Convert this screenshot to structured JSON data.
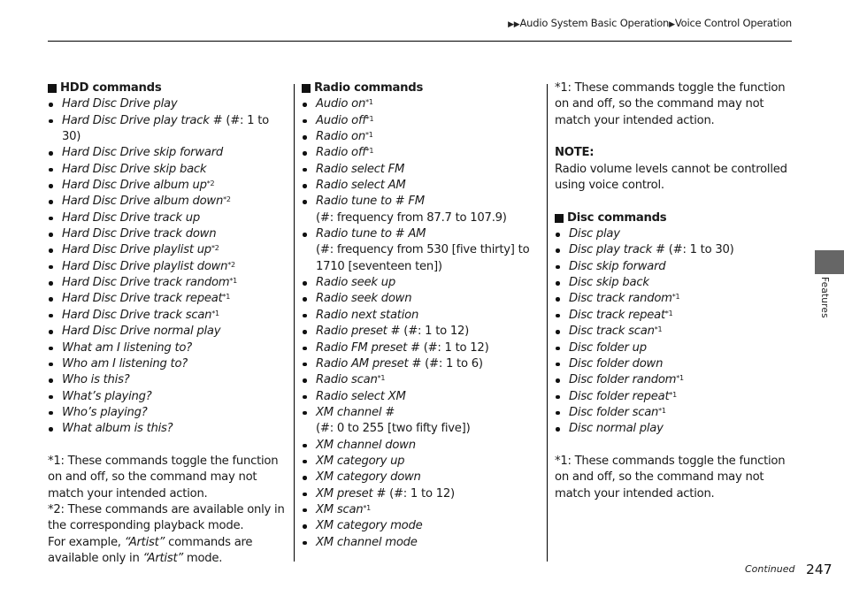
{
  "header": {
    "breadcrumb": [
      {
        "marker": "▶▶",
        "label": "Audio System Basic Operation"
      },
      {
        "marker": "▶",
        "label": "Voice Control Operation"
      }
    ]
  },
  "columns": {
    "hdd": {
      "title": "HDD commands",
      "items": [
        {
          "text": "Hard Disc Drive play",
          "suffix": "",
          "sup": ""
        },
        {
          "text": "Hard Disc Drive play track",
          "suffix": " # (#: 1 to 30)",
          "sup": ""
        },
        {
          "text": "Hard Disc Drive skip forward",
          "suffix": "",
          "sup": ""
        },
        {
          "text": "Hard Disc Drive skip back",
          "suffix": "",
          "sup": ""
        },
        {
          "text": "Hard Disc Drive album up",
          "suffix": "",
          "sup": "*2"
        },
        {
          "text": "Hard Disc Drive album down",
          "suffix": "",
          "sup": "*2"
        },
        {
          "text": "Hard Disc Drive track up",
          "suffix": "",
          "sup": ""
        },
        {
          "text": "Hard Disc Drive track down",
          "suffix": "",
          "sup": ""
        },
        {
          "text": "Hard Disc Drive playlist up",
          "suffix": "",
          "sup": "*2"
        },
        {
          "text": "Hard Disc Drive playlist down",
          "suffix": "",
          "sup": "*2"
        },
        {
          "text": "Hard Disc Drive track random",
          "suffix": "",
          "sup": "*1"
        },
        {
          "text": "Hard Disc Drive track repeat",
          "suffix": "",
          "sup": "*1"
        },
        {
          "text": "Hard Disc Drive track scan",
          "suffix": "",
          "sup": "*1"
        },
        {
          "text": "Hard Disc Drive normal play",
          "suffix": "",
          "sup": ""
        },
        {
          "text": "What am I listening to?",
          "suffix": "",
          "sup": ""
        },
        {
          "text": "Who am I listening to?",
          "suffix": "",
          "sup": ""
        },
        {
          "text": "Who is this?",
          "suffix": "",
          "sup": ""
        },
        {
          "text": "What’s playing?",
          "suffix": "",
          "sup": ""
        },
        {
          "text": "Who’s playing?",
          "suffix": "",
          "sup": ""
        },
        {
          "text": "What album is this?",
          "suffix": "",
          "sup": ""
        }
      ],
      "footnote1": "*1: These commands toggle the function on and off, so the command may not match your intended action.",
      "footnote2": "*2: These commands are available only in the corresponding playback mode.",
      "example_pre": "For example, ",
      "example_q1": "“Artist”",
      "example_mid": " commands are available only in ",
      "example_q2": "“Artist”",
      "example_post": " mode."
    },
    "radio": {
      "title": "Radio commands",
      "items": [
        {
          "text": "Audio on",
          "suffix": "",
          "sup": "*1",
          "sub": ""
        },
        {
          "text": "Audio off",
          "suffix": "",
          "sup": "*1",
          "sub": ""
        },
        {
          "text": "Radio on",
          "suffix": "",
          "sup": "*1",
          "sub": ""
        },
        {
          "text": "Radio off",
          "suffix": "",
          "sup": "*1",
          "sub": ""
        },
        {
          "text": "Radio select FM",
          "suffix": "",
          "sup": "",
          "sub": ""
        },
        {
          "text": "Radio select AM",
          "suffix": "",
          "sup": "",
          "sub": ""
        },
        {
          "text": "Radio tune to # FM",
          "suffix": "",
          "sup": "",
          "sub": "(#: frequency from 87.7 to 107.9)"
        },
        {
          "text": "Radio tune to # AM",
          "suffix": "",
          "sup": "",
          "sub": "(#: frequency from 530 [five thirty] to 1710 [seventeen ten])"
        },
        {
          "text": "Radio seek up",
          "suffix": "",
          "sup": "",
          "sub": ""
        },
        {
          "text": "Radio seek down",
          "suffix": "",
          "sup": "",
          "sub": ""
        },
        {
          "text": "Radio next station",
          "suffix": "",
          "sup": "",
          "sub": ""
        },
        {
          "text": "Radio preset",
          "suffix": " # (#: 1 to 12)",
          "sup": "",
          "sub": ""
        },
        {
          "text": "Radio FM preset",
          "suffix": " # (#: 1 to 12)",
          "sup": "",
          "sub": ""
        },
        {
          "text": "Radio AM preset",
          "suffix": " # (#: 1 to 6)",
          "sup": "",
          "sub": ""
        },
        {
          "text": "Radio scan",
          "suffix": "",
          "sup": "*1",
          "sub": ""
        },
        {
          "text": "Radio select XM",
          "suffix": "",
          "sup": "",
          "sub": ""
        },
        {
          "text": "XM channel",
          "suffix": " #",
          "sup": "",
          "sub": "(#: 0 to 255 [two fifty five])"
        },
        {
          "text": "XM channel down",
          "suffix": "",
          "sup": "",
          "sub": ""
        },
        {
          "text": "XM category up",
          "suffix": "",
          "sup": "",
          "sub": ""
        },
        {
          "text": "XM category down",
          "suffix": "",
          "sup": "",
          "sub": ""
        },
        {
          "text": "XM preset",
          "suffix": " # (#: 1 to 12)",
          "sup": "",
          "sub": ""
        },
        {
          "text": "XM scan",
          "suffix": "",
          "sup": "*1",
          "sub": ""
        },
        {
          "text": "XM category mode",
          "suffix": "",
          "sup": "",
          "sub": ""
        },
        {
          "text": "XM channel mode",
          "suffix": "",
          "sup": "",
          "sub": ""
        }
      ]
    },
    "disc": {
      "top_footnote": "*1: These commands toggle the function on and off, so the command may not match your intended action.",
      "note_title": "NOTE:",
      "note_text": "Radio volume levels cannot be controlled using voice control.",
      "title": "Disc commands",
      "items": [
        {
          "text": "Disc play",
          "suffix": "",
          "sup": ""
        },
        {
          "text": "Disc play track",
          "suffix": " # (#: 1 to 30)",
          "sup": ""
        },
        {
          "text": "Disc skip forward",
          "suffix": "",
          "sup": ""
        },
        {
          "text": "Disc skip back",
          "suffix": "",
          "sup": ""
        },
        {
          "text": "Disc track random",
          "suffix": "",
          "sup": "*1"
        },
        {
          "text": "Disc track repeat",
          "suffix": "",
          "sup": "*1"
        },
        {
          "text": "Disc track scan",
          "suffix": "",
          "sup": "*1"
        },
        {
          "text": "Disc folder up",
          "suffix": "",
          "sup": ""
        },
        {
          "text": "Disc folder down",
          "suffix": "",
          "sup": ""
        },
        {
          "text": "Disc folder random",
          "suffix": "",
          "sup": "*1"
        },
        {
          "text": "Disc folder repeat",
          "suffix": "",
          "sup": "*1"
        },
        {
          "text": "Disc folder scan",
          "suffix": "",
          "sup": "*1"
        },
        {
          "text": "Disc normal play",
          "suffix": "",
          "sup": ""
        }
      ],
      "footnote1": "*1: These commands toggle the function on and off, so the command may not match your intended action."
    }
  },
  "side_tab": {
    "label": "Features",
    "color": "#666666"
  },
  "footer": {
    "continued": "Continued",
    "page_number": "247"
  }
}
